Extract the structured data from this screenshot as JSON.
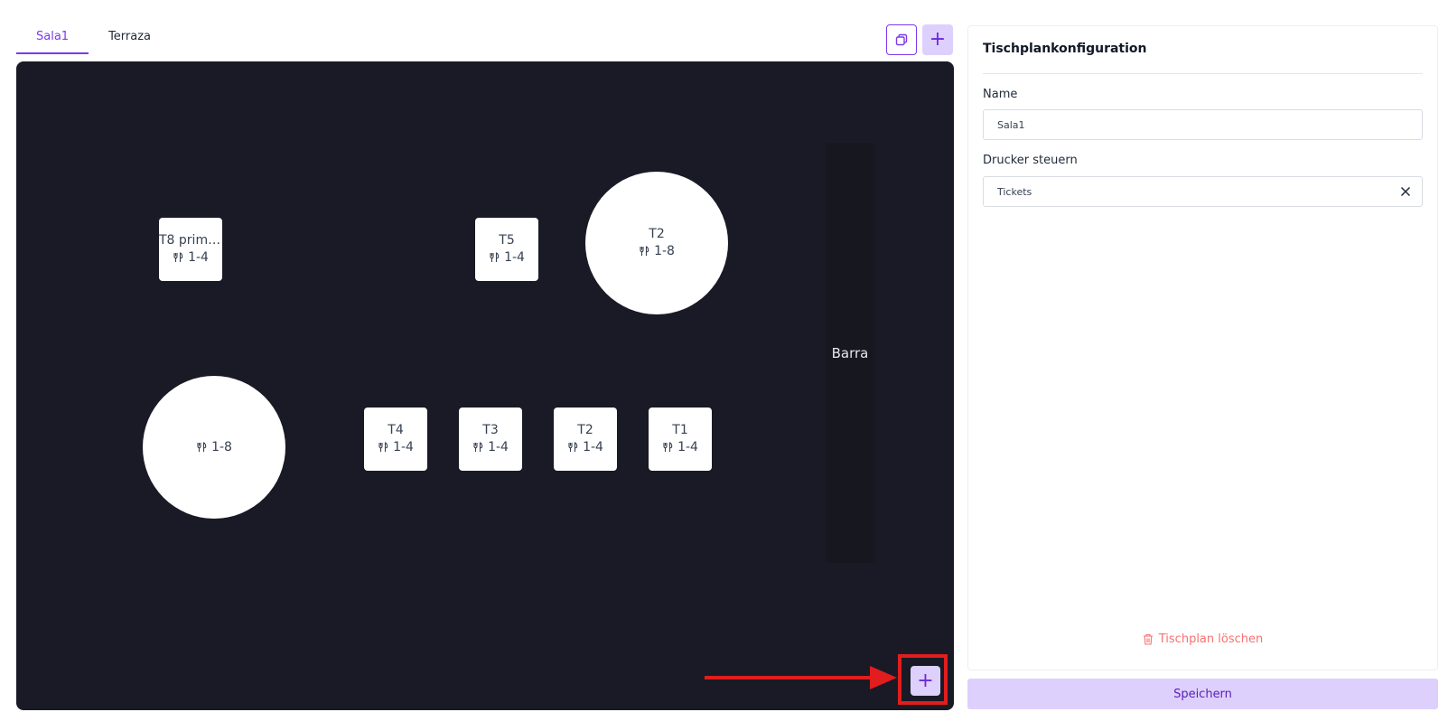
{
  "tabs": [
    {
      "label": "Sala1",
      "active": true
    },
    {
      "label": "Terraza",
      "active": false
    }
  ],
  "toolbar": {
    "copy_icon": "copy-icon",
    "add_icon": "plus-icon",
    "add_symbol": "+"
  },
  "floor_plan": {
    "tables": [
      {
        "name": "T8 prime...",
        "seats": "1-4",
        "shape": "square"
      },
      {
        "name": "T5",
        "seats": "1-4",
        "shape": "square"
      },
      {
        "name": "T2",
        "seats": "1-8",
        "shape": "round"
      },
      {
        "name": "",
        "seats": "1-8",
        "shape": "round"
      },
      {
        "name": "T4",
        "seats": "1-4",
        "shape": "square"
      },
      {
        "name": "T3",
        "seats": "1-4",
        "shape": "square"
      },
      {
        "name": "T2",
        "seats": "1-4",
        "shape": "square"
      },
      {
        "name": "T1",
        "seats": "1-4",
        "shape": "square"
      }
    ],
    "bar_label": "Barra",
    "add_symbol": "+"
  },
  "panel": {
    "title": "Tischplankonfiguration",
    "name_label": "Name",
    "name_value": "Sala1",
    "printer_label": "Drucker steuern",
    "printer_value": "Tickets",
    "delete_label": "Tischplan löschen"
  },
  "save_label": "Speichern",
  "colors": {
    "accent": "#7c3aed",
    "canvas": "#1a1a26",
    "highlight": "#e11d1d",
    "button_bg": "#ddd0fc",
    "danger": "#f87171"
  }
}
